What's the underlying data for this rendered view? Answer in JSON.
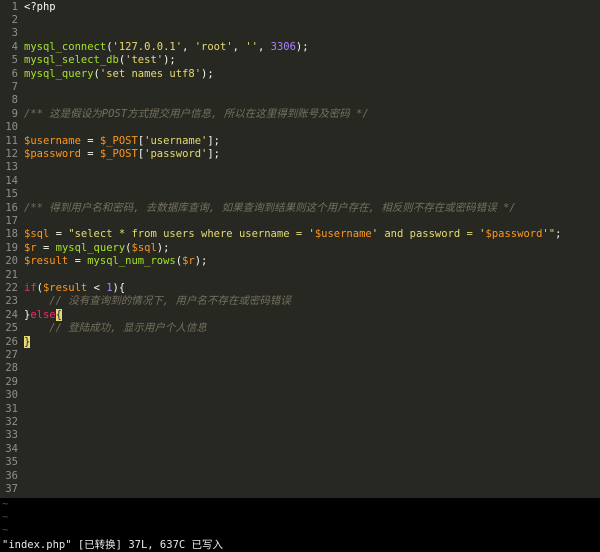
{
  "editor": {
    "lines": [
      {
        "n": "1",
        "t": [
          [
            "plain",
            "<?php"
          ]
        ]
      },
      {
        "n": "2",
        "t": []
      },
      {
        "n": "3",
        "t": []
      },
      {
        "n": "4",
        "t": [
          [
            "fn",
            "mysql_connect"
          ],
          [
            "plain",
            "("
          ],
          [
            "str",
            "'127.0.0.1'"
          ],
          [
            "plain",
            ", "
          ],
          [
            "str",
            "'root'"
          ],
          [
            "plain",
            ", "
          ],
          [
            "str",
            "''"
          ],
          [
            "plain",
            ", "
          ],
          [
            "num",
            "3306"
          ],
          [
            "plain",
            ");"
          ]
        ]
      },
      {
        "n": "5",
        "t": [
          [
            "fn",
            "mysql_select_db"
          ],
          [
            "plain",
            "("
          ],
          [
            "str",
            "'test'"
          ],
          [
            "plain",
            ");"
          ]
        ]
      },
      {
        "n": "6",
        "t": [
          [
            "fn",
            "mysql_query"
          ],
          [
            "plain",
            "("
          ],
          [
            "str",
            "'set names utf8'"
          ],
          [
            "plain",
            ");"
          ]
        ]
      },
      {
        "n": "7",
        "t": []
      },
      {
        "n": "8",
        "t": []
      },
      {
        "n": "9",
        "t": [
          [
            "cm",
            "/** 这是假设为POST方式提交用户信息, 所以在这里得到账号及密码 */"
          ]
        ]
      },
      {
        "n": "10",
        "t": []
      },
      {
        "n": "11",
        "t": [
          [
            "var",
            "$username"
          ],
          [
            "plain",
            " = "
          ],
          [
            "var",
            "$_POST"
          ],
          [
            "plain",
            "["
          ],
          [
            "str",
            "'username'"
          ],
          [
            "plain",
            "];"
          ]
        ]
      },
      {
        "n": "12",
        "t": [
          [
            "var",
            "$password"
          ],
          [
            "plain",
            " = "
          ],
          [
            "var",
            "$_POST"
          ],
          [
            "plain",
            "["
          ],
          [
            "str",
            "'password'"
          ],
          [
            "plain",
            "];"
          ]
        ]
      },
      {
        "n": "13",
        "t": []
      },
      {
        "n": "14",
        "t": []
      },
      {
        "n": "15",
        "t": []
      },
      {
        "n": "16",
        "t": [
          [
            "cm",
            "/** 得到用户名和密码, 去数据库查询, 如果查询到结果则这个用户存在, 相反则不存在或密码错误 */"
          ]
        ]
      },
      {
        "n": "17",
        "t": []
      },
      {
        "n": "18",
        "t": [
          [
            "var",
            "$sql"
          ],
          [
            "plain",
            " = "
          ],
          [
            "str",
            "\"select * from users where username = '"
          ],
          [
            "var",
            "$username"
          ],
          [
            "str",
            "' and password = '"
          ],
          [
            "var",
            "$password"
          ],
          [
            "str",
            "'\""
          ],
          [
            "plain",
            ";"
          ]
        ]
      },
      {
        "n": "19",
        "t": [
          [
            "var",
            "$r"
          ],
          [
            "plain",
            " = "
          ],
          [
            "fn",
            "mysql_query"
          ],
          [
            "plain",
            "("
          ],
          [
            "var",
            "$sql"
          ],
          [
            "plain",
            ");"
          ]
        ]
      },
      {
        "n": "20",
        "t": [
          [
            "var",
            "$result"
          ],
          [
            "plain",
            " = "
          ],
          [
            "fn",
            "mysql_num_rows"
          ],
          [
            "plain",
            "("
          ],
          [
            "var",
            "$r"
          ],
          [
            "plain",
            ");"
          ]
        ]
      },
      {
        "n": "21",
        "t": []
      },
      {
        "n": "22",
        "t": [
          [
            "kw",
            "if"
          ],
          [
            "plain",
            "("
          ],
          [
            "var",
            "$result"
          ],
          [
            "plain",
            " < "
          ],
          [
            "num",
            "1"
          ],
          [
            "plain",
            "){"
          ]
        ]
      },
      {
        "n": "23",
        "t": [
          [
            "plain",
            "    "
          ],
          [
            "cm",
            "// 没有查询到的情况下, 用户名不存在或密码错误"
          ]
        ]
      },
      {
        "n": "24",
        "t": [
          [
            "plain",
            "}"
          ],
          [
            "kw",
            "else"
          ],
          [
            "cursor",
            "{"
          ]
        ]
      },
      {
        "n": "25",
        "t": [
          [
            "plain",
            "    "
          ],
          [
            "cm",
            "// 登陆成功, 显示用户个人信息"
          ]
        ]
      },
      {
        "n": "26",
        "t": [
          [
            "cursor",
            "}"
          ]
        ]
      },
      {
        "n": "27",
        "t": []
      },
      {
        "n": "28",
        "t": []
      },
      {
        "n": "29",
        "t": []
      },
      {
        "n": "30",
        "t": []
      },
      {
        "n": "31",
        "t": []
      },
      {
        "n": "32",
        "t": []
      },
      {
        "n": "33",
        "t": []
      },
      {
        "n": "34",
        "t": []
      },
      {
        "n": "35",
        "t": []
      },
      {
        "n": "36",
        "t": []
      },
      {
        "n": "37",
        "t": []
      }
    ]
  },
  "tildes": [
    "~",
    "~",
    "~"
  ],
  "status": {
    "text": "\"index.php\" [已转换] 37L, 637C 已写入"
  }
}
